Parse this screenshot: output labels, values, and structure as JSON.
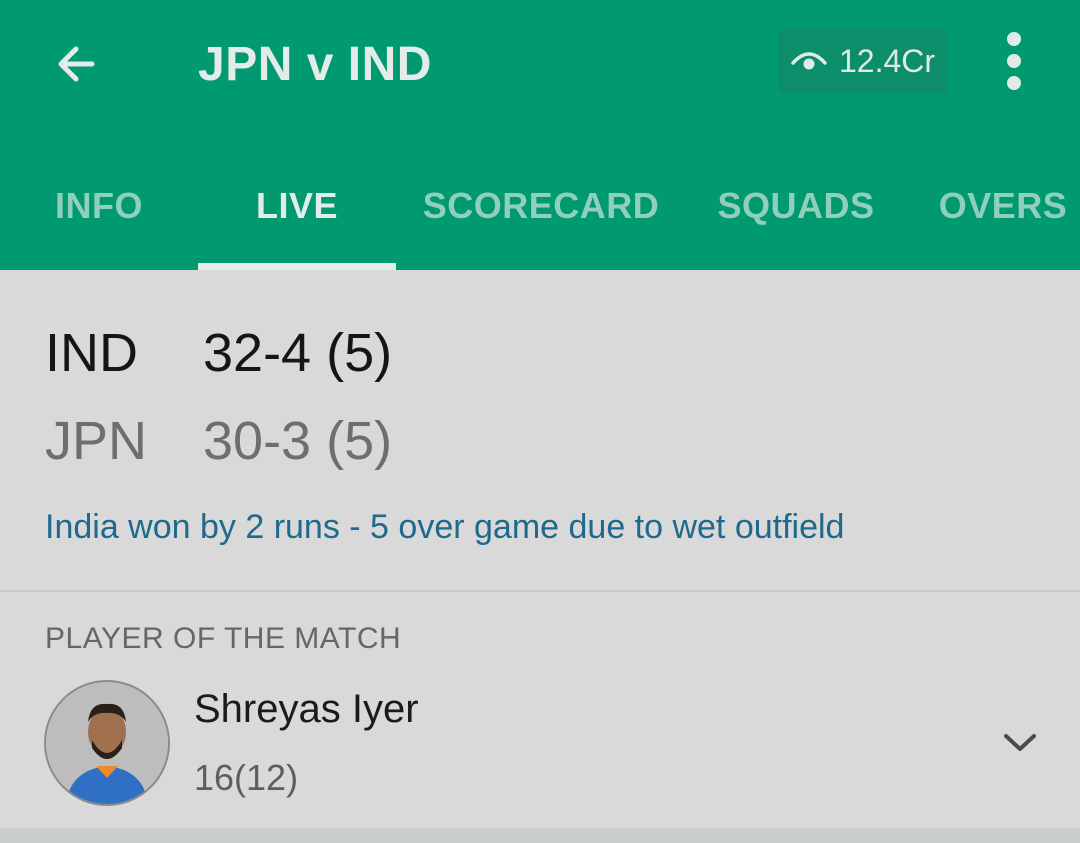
{
  "header": {
    "title": "JPN v IND",
    "views": "12.4Cr",
    "icons": {
      "back": "arrow-left-icon",
      "views": "eye-icon",
      "menu": "more-vertical-icon"
    }
  },
  "tabs": [
    {
      "label": "INFO",
      "active": false
    },
    {
      "label": "LIVE",
      "active": true
    },
    {
      "label": "SCORECARD",
      "active": false
    },
    {
      "label": "SQUADS",
      "active": false
    },
    {
      "label": "OVERS",
      "active": false
    }
  ],
  "score": {
    "teams": [
      {
        "abbr": "IND",
        "score": "32-4 (5)",
        "status": "winner"
      },
      {
        "abbr": "JPN",
        "score": "30-3 (5)",
        "status": "loser"
      }
    ],
    "result": "India won by 2 runs  -  5 over game due to wet outfield"
  },
  "player_of_match": {
    "label": "PLAYER OF THE MATCH",
    "name": "Shreyas Iyer",
    "stat": "16(12)",
    "expand_icon": "chevron-down-icon"
  },
  "colors": {
    "appbar": "#009970",
    "result_text": "#1f6a8c",
    "background": "#d9d9d9"
  }
}
